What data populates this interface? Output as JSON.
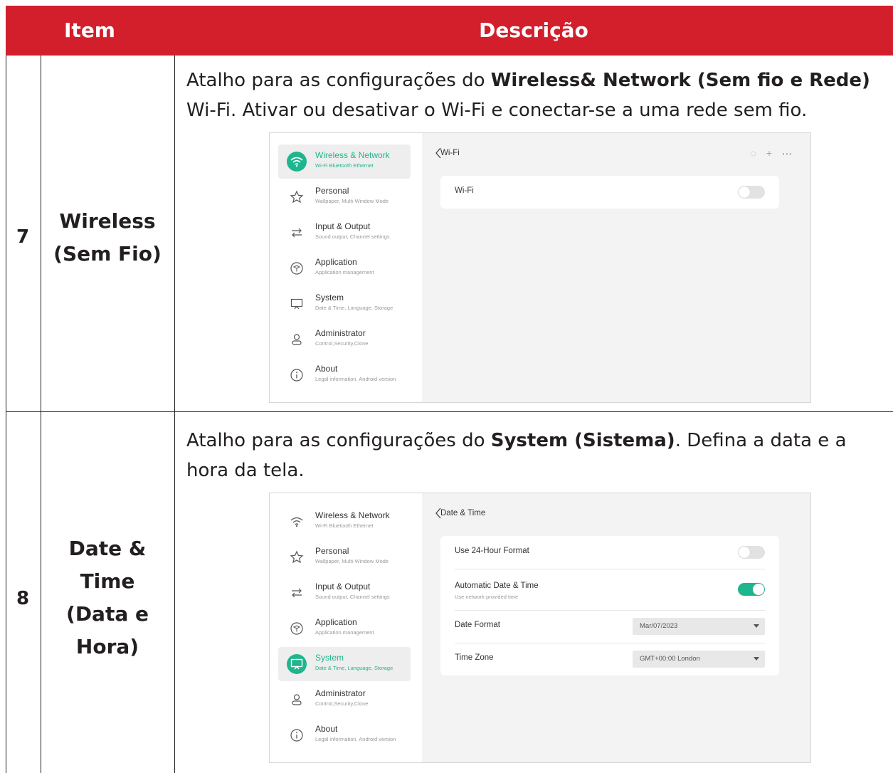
{
  "table": {
    "header": {
      "item": "Item",
      "description": "Descrição"
    },
    "rows": [
      {
        "number": "7",
        "name_line1": "Wireless",
        "name_line2": "(Sem Fio)",
        "desc_prefix": "Atalho para as configurações do ",
        "desc_bold": "Wireless& Network (Sem fio e Rede)",
        "desc_suffix": " Wi-Fi. Ativar ou desativar o Wi-Fi e conectar-se a uma rede sem fio."
      },
      {
        "number": "8",
        "name_line1": "Date &",
        "name_line2": "Time",
        "name_line3": "(Data e",
        "name_line4": "Hora)",
        "desc_prefix": "Atalho para as configurações do ",
        "desc_bold": "System (Sistema)",
        "desc_suffix": ". Defina a data e a hora da tela."
      }
    ]
  },
  "sidebar": {
    "items": [
      {
        "title": "Wireless & Network",
        "subtitle": "Wi-Fi Bluetooth Ethernet",
        "icon": "wifi-icon"
      },
      {
        "title": "Personal",
        "subtitle": "Wallpaper, Multi-Window Mode",
        "icon": "star-icon"
      },
      {
        "title": "Input & Output",
        "subtitle": "Sound output, Channel settings",
        "icon": "arrows-icon"
      },
      {
        "title": "Application",
        "subtitle": "Application management",
        "icon": "cube-icon"
      },
      {
        "title": "System",
        "subtitle": "Date & Time, Language, Storage",
        "icon": "monitor-icon"
      },
      {
        "title": "Administrator",
        "subtitle": "Control,Security,Clone",
        "icon": "user-icon"
      },
      {
        "title": "About",
        "subtitle": "Legal information, Android version",
        "icon": "info-icon"
      }
    ]
  },
  "wifi_screen": {
    "title": "Wi-Fi",
    "toolbar_icons": [
      "refresh-icon",
      "plus-icon",
      "more-icon"
    ],
    "toolbar_glyphs": [
      "◌",
      "+",
      "···"
    ],
    "row_label": "Wi-Fi",
    "wifi_enabled": false
  },
  "datetime_screen": {
    "title": "Date & Time",
    "use_24h_label": "Use 24-Hour Format",
    "use_24h_enabled": false,
    "auto_label": "Automatic Date & Time",
    "auto_sublabel": "Use network-provided time",
    "auto_enabled": true,
    "date_format_label": "Date Format",
    "date_format_value": "Mar/07/2023",
    "time_zone_label": "Time Zone",
    "time_zone_value": "GMT+00:00 London"
  },
  "colors": {
    "header_red": "#d31f2c",
    "accent_green": "#1fb58e"
  }
}
